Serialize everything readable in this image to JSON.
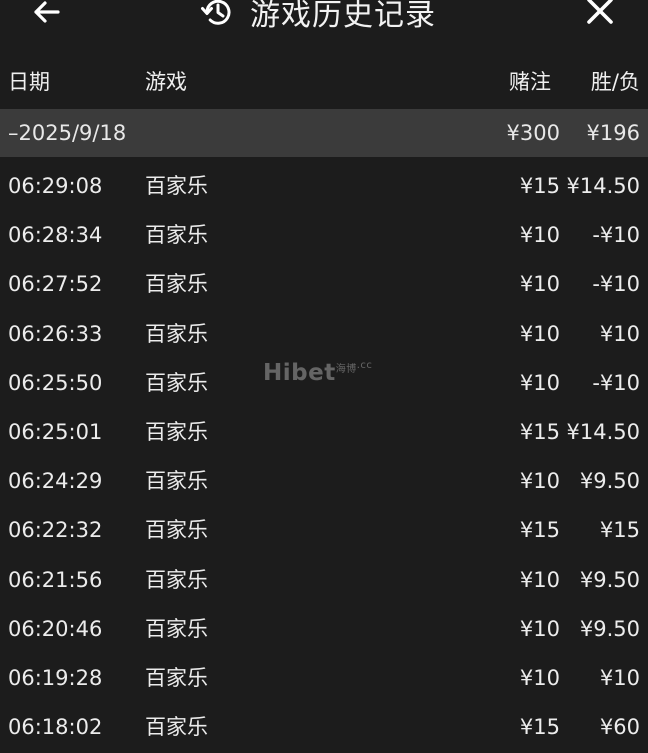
{
  "header": {
    "title": "游戏历史记录",
    "back_icon": "arrow-left-icon",
    "history_icon": "history-clock-icon",
    "close_icon": "close-icon"
  },
  "columns": {
    "date": "日期",
    "game": "游戏",
    "bet": "赌注",
    "win_loss": "胜/负"
  },
  "summary": {
    "date": "–2025/9/18",
    "bet": "¥300",
    "win_loss": "¥196"
  },
  "rows": [
    {
      "time": "06:29:08",
      "game": "百家乐",
      "bet": "¥15",
      "win_loss": "¥14.50"
    },
    {
      "time": "06:28:34",
      "game": "百家乐",
      "bet": "¥10",
      "win_loss": "-¥10"
    },
    {
      "time": "06:27:52",
      "game": "百家乐",
      "bet": "¥10",
      "win_loss": "-¥10"
    },
    {
      "time": "06:26:33",
      "game": "百家乐",
      "bet": "¥10",
      "win_loss": "¥10"
    },
    {
      "time": "06:25:50",
      "game": "百家乐",
      "bet": "¥10",
      "win_loss": "-¥10"
    },
    {
      "time": "06:25:01",
      "game": "百家乐",
      "bet": "¥15",
      "win_loss": "¥14.50"
    },
    {
      "time": "06:24:29",
      "game": "百家乐",
      "bet": "¥10",
      "win_loss": "¥9.50"
    },
    {
      "time": "06:22:32",
      "game": "百家乐",
      "bet": "¥15",
      "win_loss": "¥15"
    },
    {
      "time": "06:21:56",
      "game": "百家乐",
      "bet": "¥10",
      "win_loss": "¥9.50"
    },
    {
      "time": "06:20:46",
      "game": "百家乐",
      "bet": "¥10",
      "win_loss": "¥9.50"
    },
    {
      "time": "06:19:28",
      "game": "百家乐",
      "bet": "¥10",
      "win_loss": "¥10"
    },
    {
      "time": "06:18:02",
      "game": "百家乐",
      "bet": "¥15",
      "win_loss": "¥60"
    }
  ],
  "watermark": {
    "brand": "Hibet",
    "cn": "海博",
    "suffix": ".cc"
  },
  "colors": {
    "background": "#1c1c1c",
    "summary_row": "#3b3b3b",
    "text": "#e8e8e8"
  }
}
